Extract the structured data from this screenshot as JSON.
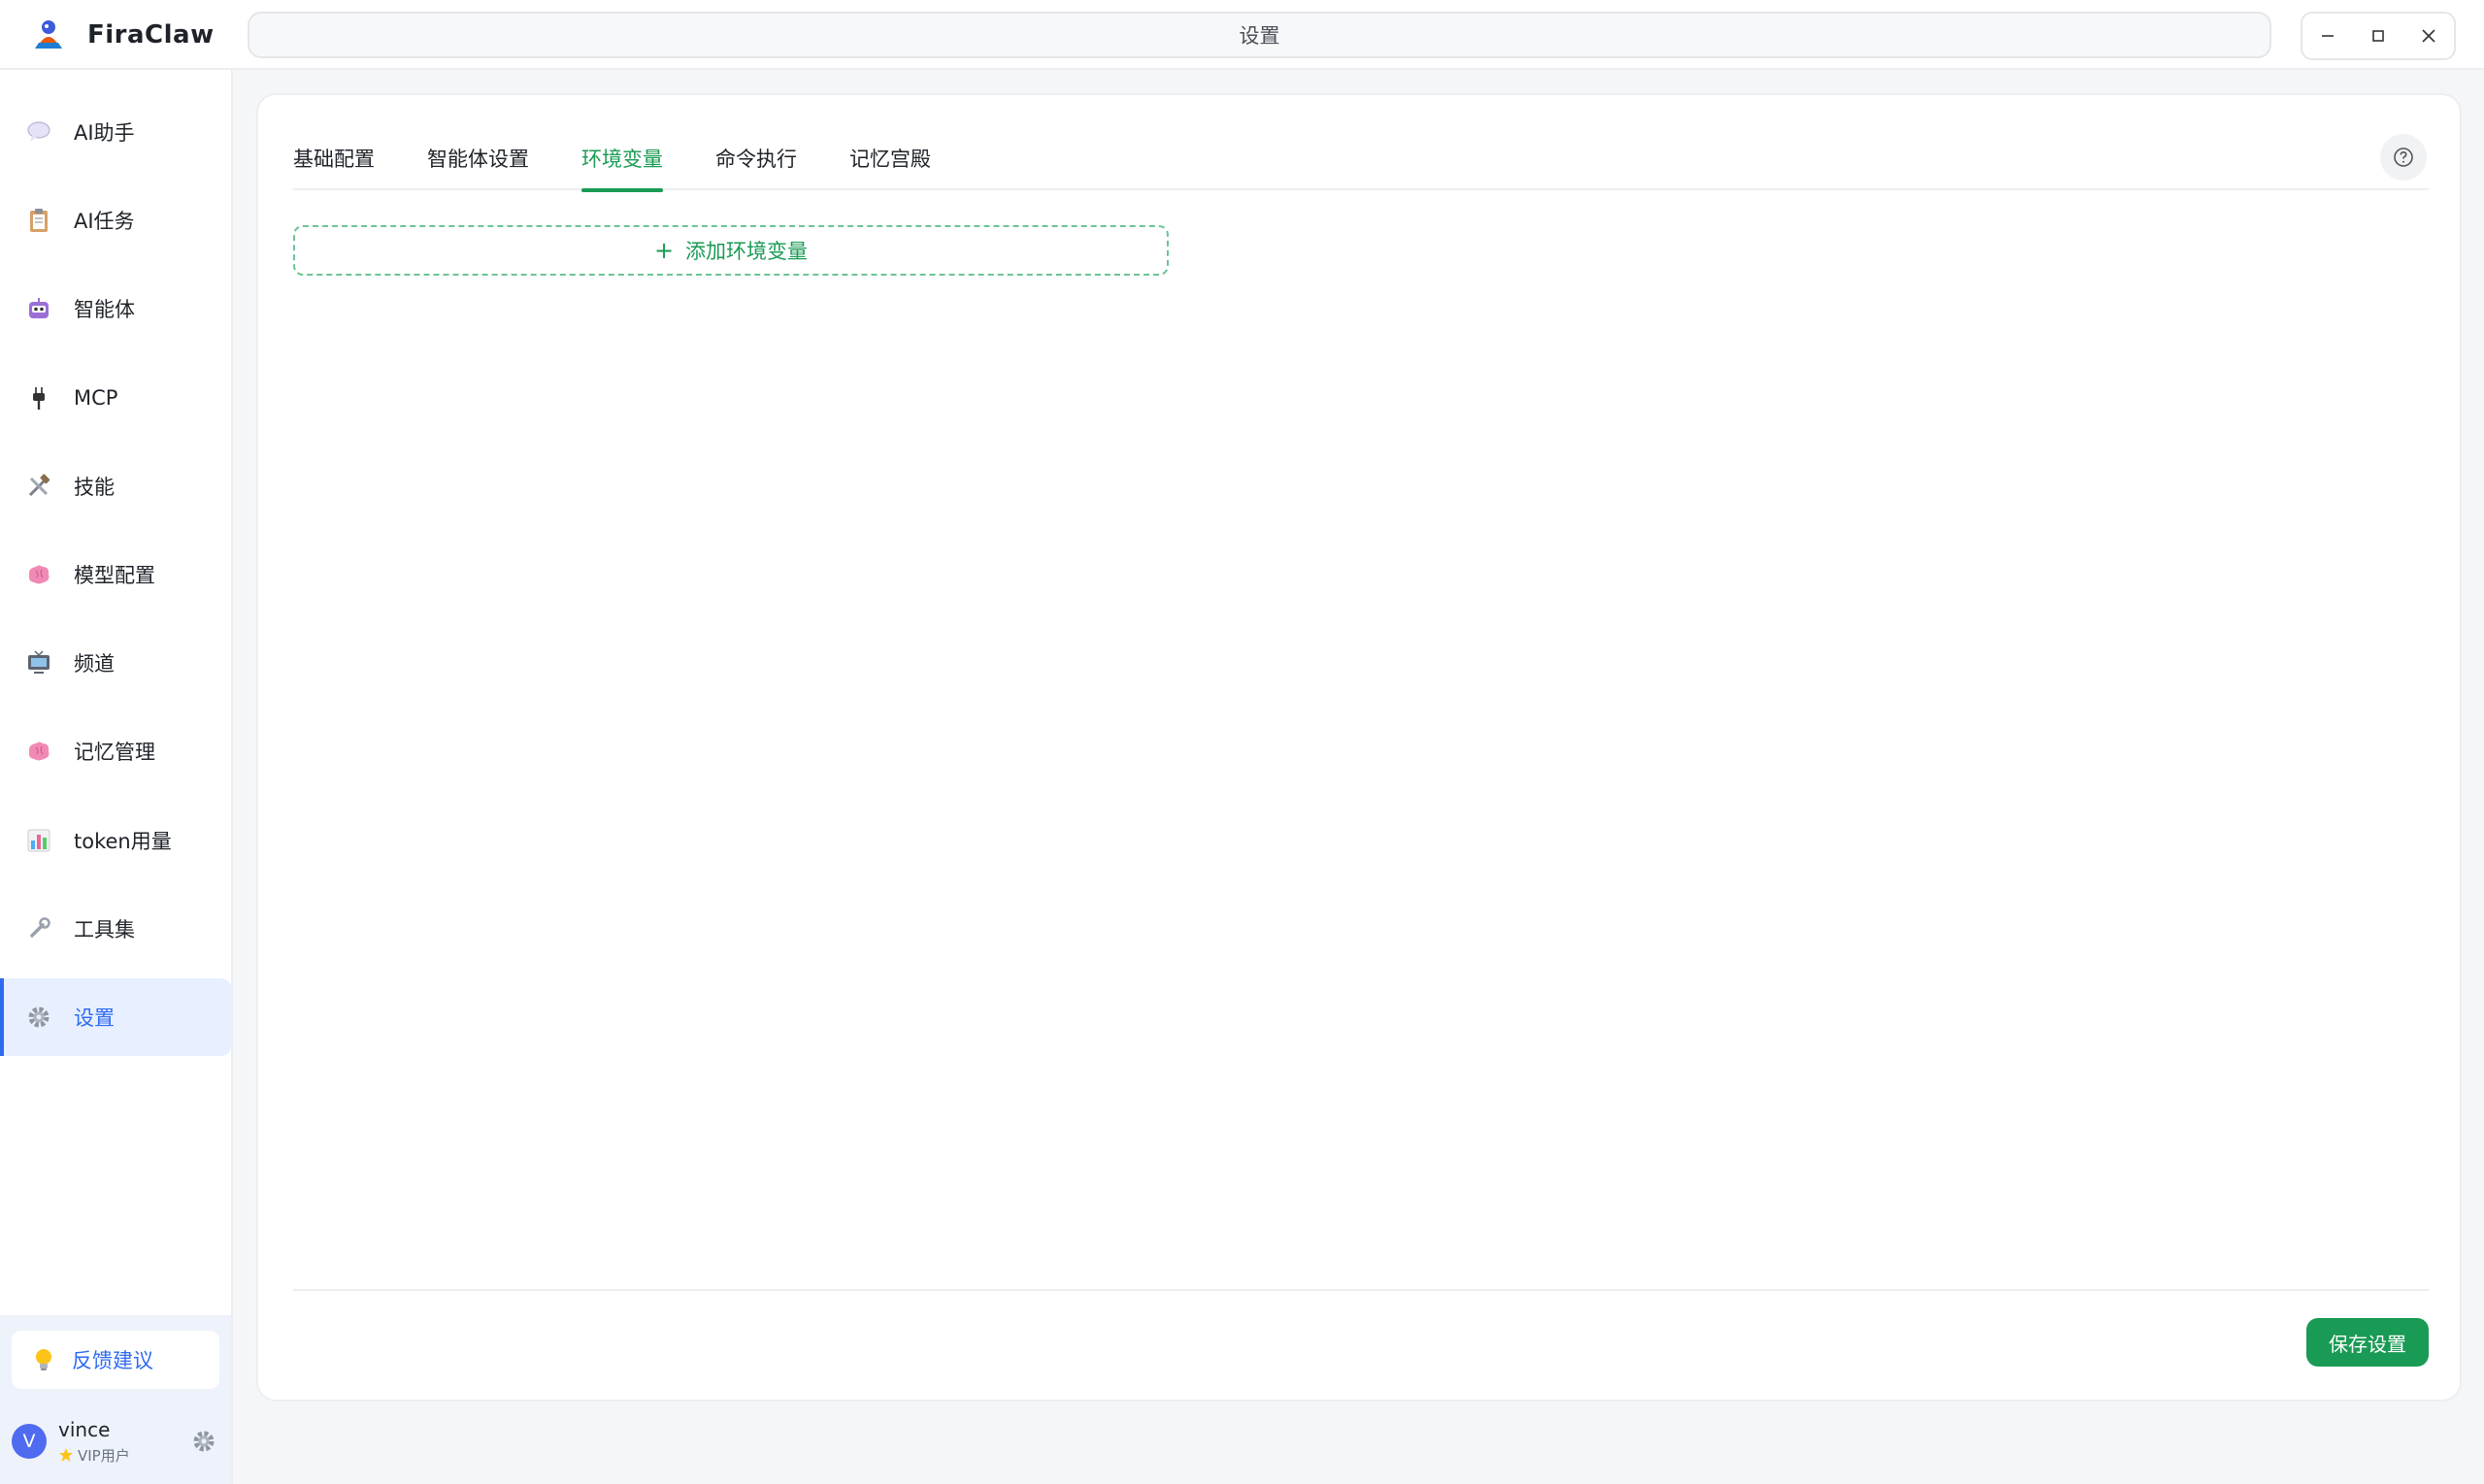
{
  "app": {
    "name": "FiraClaw"
  },
  "titlebar": {
    "search_text": "设置"
  },
  "window_controls": {
    "minimize_icon": "minimize-icon",
    "maximize_icon": "maximize-icon",
    "close_icon": "close-icon"
  },
  "sidebar": {
    "items": [
      {
        "label": "AI助手",
        "icon": "chat-bubble-icon"
      },
      {
        "label": "AI任务",
        "icon": "clipboard-icon"
      },
      {
        "label": "智能体",
        "icon": "robot-icon"
      },
      {
        "label": "MCP",
        "icon": "plug-icon"
      },
      {
        "label": "技能",
        "icon": "tools-icon"
      },
      {
        "label": "模型配置",
        "icon": "brain-icon"
      },
      {
        "label": "频道",
        "icon": "tv-icon"
      },
      {
        "label": "记忆管理",
        "icon": "brain-icon"
      },
      {
        "label": "token用量",
        "icon": "bar-chart-icon"
      },
      {
        "label": "工具集",
        "icon": "wrench-icon"
      },
      {
        "label": "设置",
        "icon": "gear-icon",
        "active": true
      }
    ],
    "feedback": {
      "label": "反馈建议",
      "icon": "lightbulb-icon"
    },
    "user": {
      "avatar_letter": "V",
      "name": "vince",
      "tier": "VIP用户"
    }
  },
  "main": {
    "tabs": [
      {
        "label": "基础配置"
      },
      {
        "label": "智能体设置"
      },
      {
        "label": "环境变量",
        "active": true
      },
      {
        "label": "命令执行"
      },
      {
        "label": "记忆宫殿"
      }
    ],
    "add_env_label": "添加环境变量",
    "save_label": "保存设置"
  },
  "colors": {
    "accent_green": "#1a9b55",
    "accent_blue": "#2f6bf0",
    "active_nav_bg": "#e8efff"
  }
}
